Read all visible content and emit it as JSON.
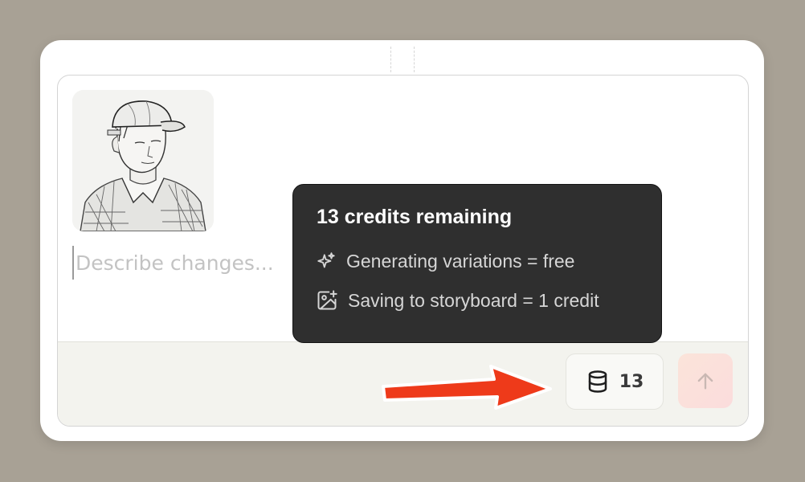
{
  "composer": {
    "prompt_placeholder": "Describe changes..."
  },
  "tooltip": {
    "title": "13 credits remaining",
    "rows": [
      {
        "icon": "sparkles-icon",
        "text": "Generating variations = free"
      },
      {
        "icon": "image-plus-icon",
        "text": "Saving to storyboard = 1 credit"
      }
    ]
  },
  "footer": {
    "credits_count": "13",
    "credits_icon": "database-icon",
    "send_icon": "arrow-up-icon"
  },
  "annotation": {
    "arrow_color": "#ee3a1a"
  }
}
